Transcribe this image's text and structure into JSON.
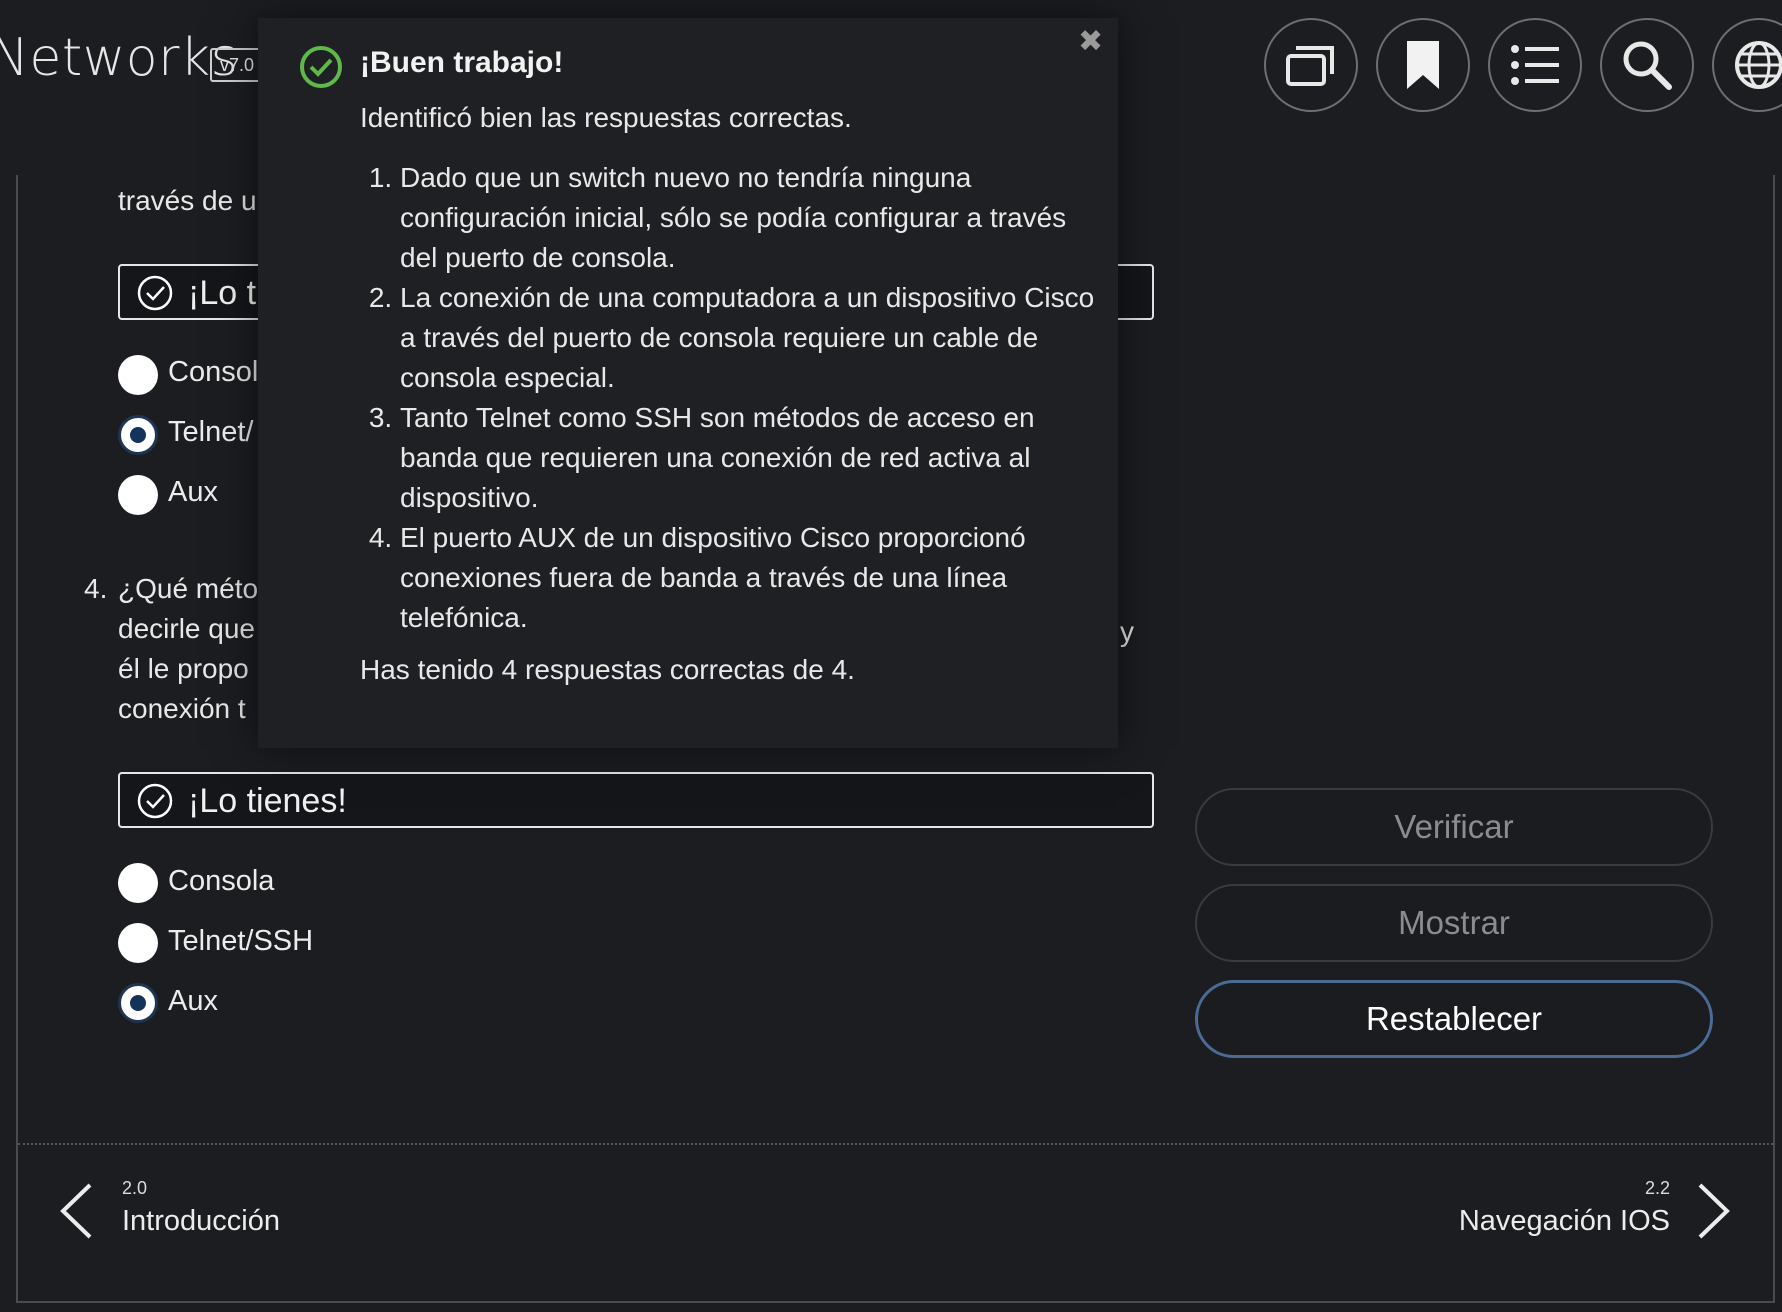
{
  "header": {
    "app_title": "Networks",
    "version": "v7.0",
    "icons": [
      "window-icon",
      "bookmark-icon",
      "list-icon",
      "search-icon",
      "globe-icon"
    ]
  },
  "question3": {
    "text_line": "través de u",
    "feedback": "¡Lo ti",
    "options": [
      "Consol",
      "Telnet/",
      "Aux"
    ],
    "selected": 1
  },
  "question4": {
    "number": "4.",
    "lines": [
      "¿Qué méto",
      "decirle que",
      "él le propo",
      "conexión t"
    ],
    "trailing_fragment": "y",
    "feedback": "¡Lo tienes!",
    "options": [
      "Consola",
      "Telnet/SSH",
      "Aux"
    ],
    "selected": 2
  },
  "actions": {
    "verify": "Verificar",
    "show": "Mostrar",
    "reset": "Restablecer"
  },
  "nav": {
    "prev_num": "2.0",
    "prev_label": "Introducción",
    "next_num": "2.2",
    "next_label": "Navegación IOS"
  },
  "popup": {
    "title": "¡Buen trabajo!",
    "intro": "Identificó bien las respuestas correctas.",
    "items": [
      "Dado que un switch nuevo no tendría ninguna configuración inicial, sólo se podía configurar a través del puerto de consola.",
      "La conexión de una computadora a un dispositivo Cisco a través del puerto de consola requiere un cable de consola especial.",
      "Tanto Telnet como SSH son métodos de acceso en banda que requieren una conexión de red activa al dispositivo.",
      "El puerto AUX de un dispositivo Cisco proporcionó conexiones fuera de banda a través de una línea telefónica."
    ],
    "score": "Has tenido 4 respuestas correctas de 4.",
    "close_symbol": "✖"
  },
  "colors": {
    "background": "#1c1d21",
    "success_green": "#5fb84a",
    "radio_selected": "#13335a",
    "active_button_border": "#4b6b96"
  }
}
